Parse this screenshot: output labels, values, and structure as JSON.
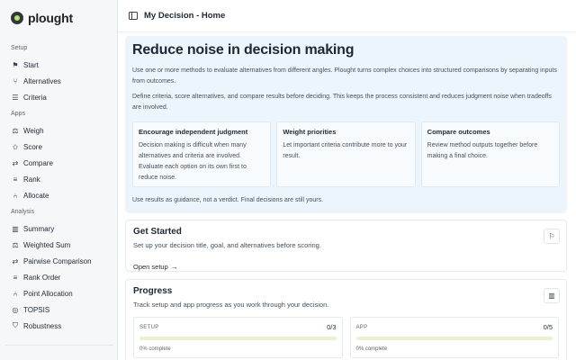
{
  "brand": {
    "name": "plought"
  },
  "sidebar": {
    "sections": [
      {
        "label": "Setup",
        "items": [
          {
            "label": "Start",
            "icon": "flag-icon"
          },
          {
            "label": "Alternatives",
            "icon": "branch-icon"
          },
          {
            "label": "Criteria",
            "icon": "list-check-icon"
          }
        ]
      },
      {
        "label": "Apps",
        "items": [
          {
            "label": "Weigh",
            "icon": "scale-icon"
          },
          {
            "label": "Score",
            "icon": "star-icon"
          },
          {
            "label": "Compare",
            "icon": "compare-arrows-icon"
          },
          {
            "label": "Rank",
            "icon": "ranking-icon"
          },
          {
            "label": "Allocate",
            "icon": "split-icon"
          }
        ]
      },
      {
        "label": "Analysis",
        "items": [
          {
            "label": "Summary",
            "icon": "bar-chart-icon"
          },
          {
            "label": "Weighted Sum",
            "icon": "scale-icon"
          },
          {
            "label": "Pairwise Comparison",
            "icon": "compare-arrows-icon"
          },
          {
            "label": "Rank Order",
            "icon": "ranking-icon"
          },
          {
            "label": "Point Allocation",
            "icon": "split-icon"
          },
          {
            "label": "TOPSIS",
            "icon": "target-icon"
          },
          {
            "label": "Robustness",
            "icon": "shield-icon"
          }
        ]
      }
    ]
  },
  "topbar": {
    "title": "My Decision - Home"
  },
  "hero": {
    "title": "Reduce noise in decision making",
    "p1": "Use one or more methods to evaluate alternatives from different angles. Plought turns complex choices into structured comparisons by separating inputs from outcomes.",
    "p2": "Define criteria, score alternatives, and compare results before deciding. This keeps the process consistent and reduces judgment noise when tradeoffs are involved.",
    "cards": [
      {
        "title": "Encourage independent judgment",
        "text": "Decision making is difficult when many alternatives and criteria are involved. Evaluate each option on its own first to reduce noise."
      },
      {
        "title": "Weight priorities",
        "text": "Let important criteria contribute more to your result."
      },
      {
        "title": "Compare outcomes",
        "text": "Review method outputs together before making a final choice."
      }
    ],
    "footnote": "Use results as guidance, not a verdict. Final decisions are still yours."
  },
  "get_started": {
    "title": "Get Started",
    "subtitle": "Set up your decision title, goal, and alternatives before scoring.",
    "link": "Open setup",
    "link_arrow": "→"
  },
  "progress": {
    "title": "Progress",
    "subtitle": "Track setup and app progress as you work through your decision.",
    "items": [
      {
        "label": "SETUP",
        "count": "0/3",
        "pct_text": "0% complete",
        "fraction": 0
      },
      {
        "label": "APP",
        "count": "0/5",
        "pct_text": "0% complete",
        "fraction": 0
      }
    ]
  },
  "colors": {
    "accent": "#b7e36c",
    "hero_bg": "#edf5fc"
  }
}
